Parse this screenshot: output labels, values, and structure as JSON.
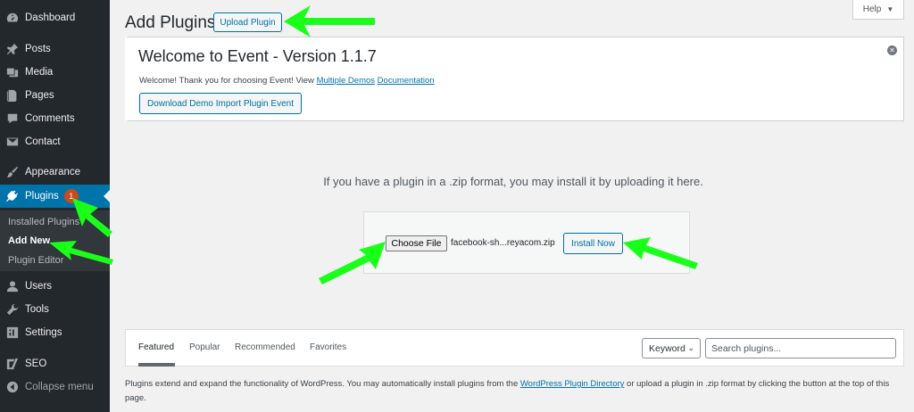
{
  "sidebar": {
    "items": [
      {
        "label": "Dashboard",
        "icon": "dashboard-icon"
      },
      {
        "label": "Posts",
        "icon": "pin-icon"
      },
      {
        "label": "Media",
        "icon": "media-icon"
      },
      {
        "label": "Pages",
        "icon": "pages-icon"
      },
      {
        "label": "Comments",
        "icon": "comment-icon"
      },
      {
        "label": "Contact",
        "icon": "mail-icon"
      },
      {
        "label": "Appearance",
        "icon": "brush-icon"
      },
      {
        "label": "Plugins",
        "icon": "plugin-icon",
        "badge": "1",
        "active": true
      },
      {
        "label": "Users",
        "icon": "user-icon"
      },
      {
        "label": "Tools",
        "icon": "wrench-icon"
      },
      {
        "label": "Settings",
        "icon": "settings-icon"
      },
      {
        "label": "SEO",
        "icon": "seo-icon"
      },
      {
        "label": "Collapse menu",
        "icon": "collapse-icon"
      }
    ],
    "submenu": [
      {
        "label": "Installed Plugins"
      },
      {
        "label": "Add New",
        "current": true
      },
      {
        "label": "Plugin Editor"
      }
    ]
  },
  "header": {
    "title": "Add Plugins",
    "upload_label": "Upload Plugin",
    "help_label": "Help"
  },
  "notice": {
    "title": "Welcome to Event - Version 1.1.7",
    "text": "Welcome! Thank you for choosing Event! View",
    "link1": "Multiple Demos",
    "link2": "Documentation",
    "button": "Download Demo Import Plugin Event"
  },
  "upload": {
    "instruction": "If you have a plugin in a .zip format, you may install it by uploading it here.",
    "choose_label": "Choose File",
    "file_name": "facebook-sh...reyacom.zip",
    "install_label": "Install Now"
  },
  "filter": {
    "tabs": [
      "Featured",
      "Popular",
      "Recommended",
      "Favorites"
    ],
    "current_tab": "Featured",
    "select_value": "Keyword",
    "search_placeholder": "Search plugins..."
  },
  "footer": {
    "text_before": "Plugins extend and expand the functionality of WordPress. You may automatically install plugins from the",
    "link": "WordPress Plugin Directory",
    "text_after": "or upload a plugin in .zip format by clicking the button at the top of this page."
  },
  "colors": {
    "sidebar_bg": "#23282d",
    "active_bg": "#0073aa",
    "accent": "#0071a1",
    "badge": "#ca4a1f",
    "arrow": "#1aff1a"
  }
}
